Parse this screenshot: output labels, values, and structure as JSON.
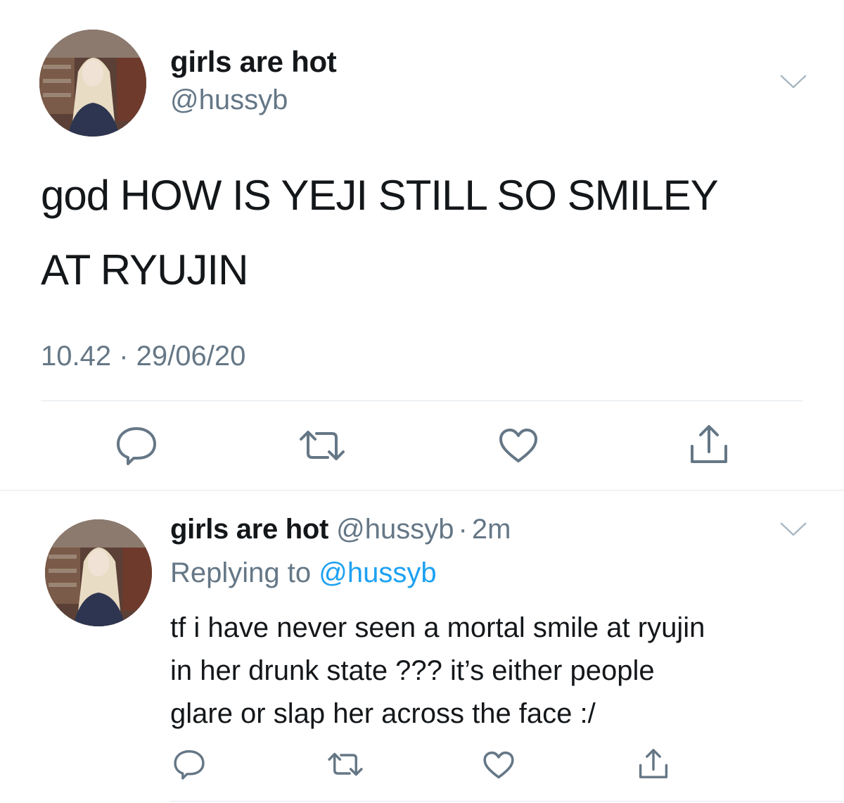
{
  "main_tweet": {
    "display_name": "girls are hot",
    "handle": "@hussyb",
    "avatar_icon": "avatar-photo",
    "text_lines": [
      "god HOW IS YEJI STILL SO SMILEY",
      "AT RYUJIN"
    ],
    "timestamp": "10.42 · 29/06/20",
    "actions": [
      "reply-icon",
      "retweet-icon",
      "like-icon",
      "share-icon"
    ]
  },
  "reply_tweet": {
    "display_name": "girls are hot",
    "handle": "@hussyb",
    "separator": "·",
    "time": "2m",
    "replying_prefix": "Replying to",
    "replying_handle": "@hussyb",
    "text_lines": [
      "tf i have never seen a mortal smile at ryujin",
      "in her drunk state ??? it’s either people",
      "glare or slap her across the face :/"
    ],
    "actions": [
      "reply-icon",
      "retweet-icon",
      "like-icon",
      "share-icon"
    ]
  },
  "colors": {
    "text": "#14171a",
    "secondary": "#657786",
    "link": "#1da1f2",
    "divider": "#e1e8ed",
    "icon": "#657786"
  }
}
